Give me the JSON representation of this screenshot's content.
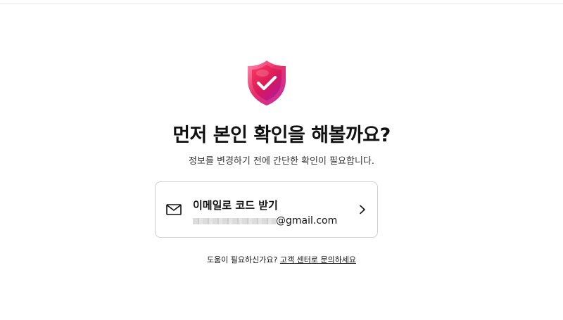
{
  "page": {
    "title": "먼저 본인 확인을 해볼까요?",
    "subtitle": "정보를 변경하기 전에 간단한 확인이 필요합니다."
  },
  "verification_option": {
    "icon": "mail-icon",
    "label": "이메일로 코드 받기",
    "email_masked": "●●●●●●●●●●",
    "email_domain": "@gmail.com",
    "chevron": "chevron-right-icon"
  },
  "help": {
    "prompt": "도움이 필요하신가요?",
    "link_label": "고객 센터로 문의하세요"
  },
  "colors": {
    "shield_gradient_top": "#ff4fa0",
    "shield_gradient_bottom": "#c1182e",
    "border": "#cfcfcf",
    "text": "#111111"
  }
}
